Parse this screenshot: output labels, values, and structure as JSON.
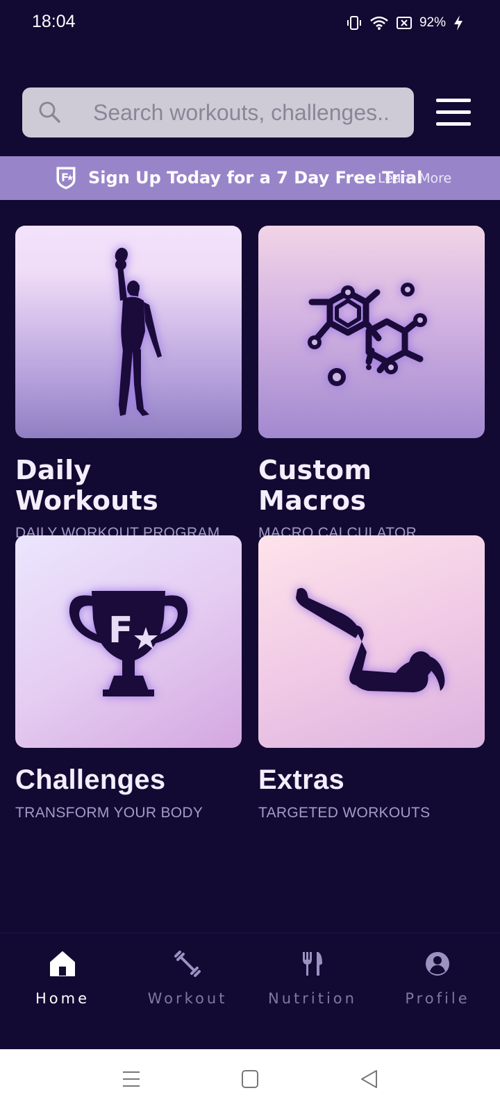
{
  "status_bar": {
    "time": "18:04",
    "battery": "92%",
    "icons": [
      "vibrate-icon",
      "wifi-icon",
      "no-sim-icon",
      "charging-icon"
    ]
  },
  "search": {
    "placeholder": "Search workouts, challenges..",
    "value": ""
  },
  "promo": {
    "text": "Sign Up Today for a 7 Day Free Trial",
    "link": "Learn More"
  },
  "cards": [
    {
      "title": "Daily Workouts",
      "subtitle": "DAILY WORKOUT PROGRAM",
      "icon": "kettlebell-woman-icon"
    },
    {
      "title": "Custom Macros",
      "subtitle": "MACRO CALCULATOR",
      "icon": "molecule-icon"
    },
    {
      "title": "Challenges",
      "subtitle": "TRANSFORM YOUR BODY",
      "icon": "trophy-icon",
      "trophy_letter": "F"
    },
    {
      "title": "Extras",
      "subtitle": "TARGETED WORKOUTS",
      "icon": "crunch-woman-icon"
    }
  ],
  "bottom_nav": [
    {
      "label": "Home",
      "icon": "home-icon",
      "active": true
    },
    {
      "label": "Workout",
      "icon": "dumbbell-icon",
      "active": false
    },
    {
      "label": "Nutrition",
      "icon": "fork-knife-icon",
      "active": false
    },
    {
      "label": "Profile",
      "icon": "profile-icon",
      "active": false
    }
  ],
  "colors": {
    "background": "#130a33",
    "banner": "#9885c9",
    "active_nav": "#ffffff",
    "inactive_nav": "#7e79a0"
  }
}
